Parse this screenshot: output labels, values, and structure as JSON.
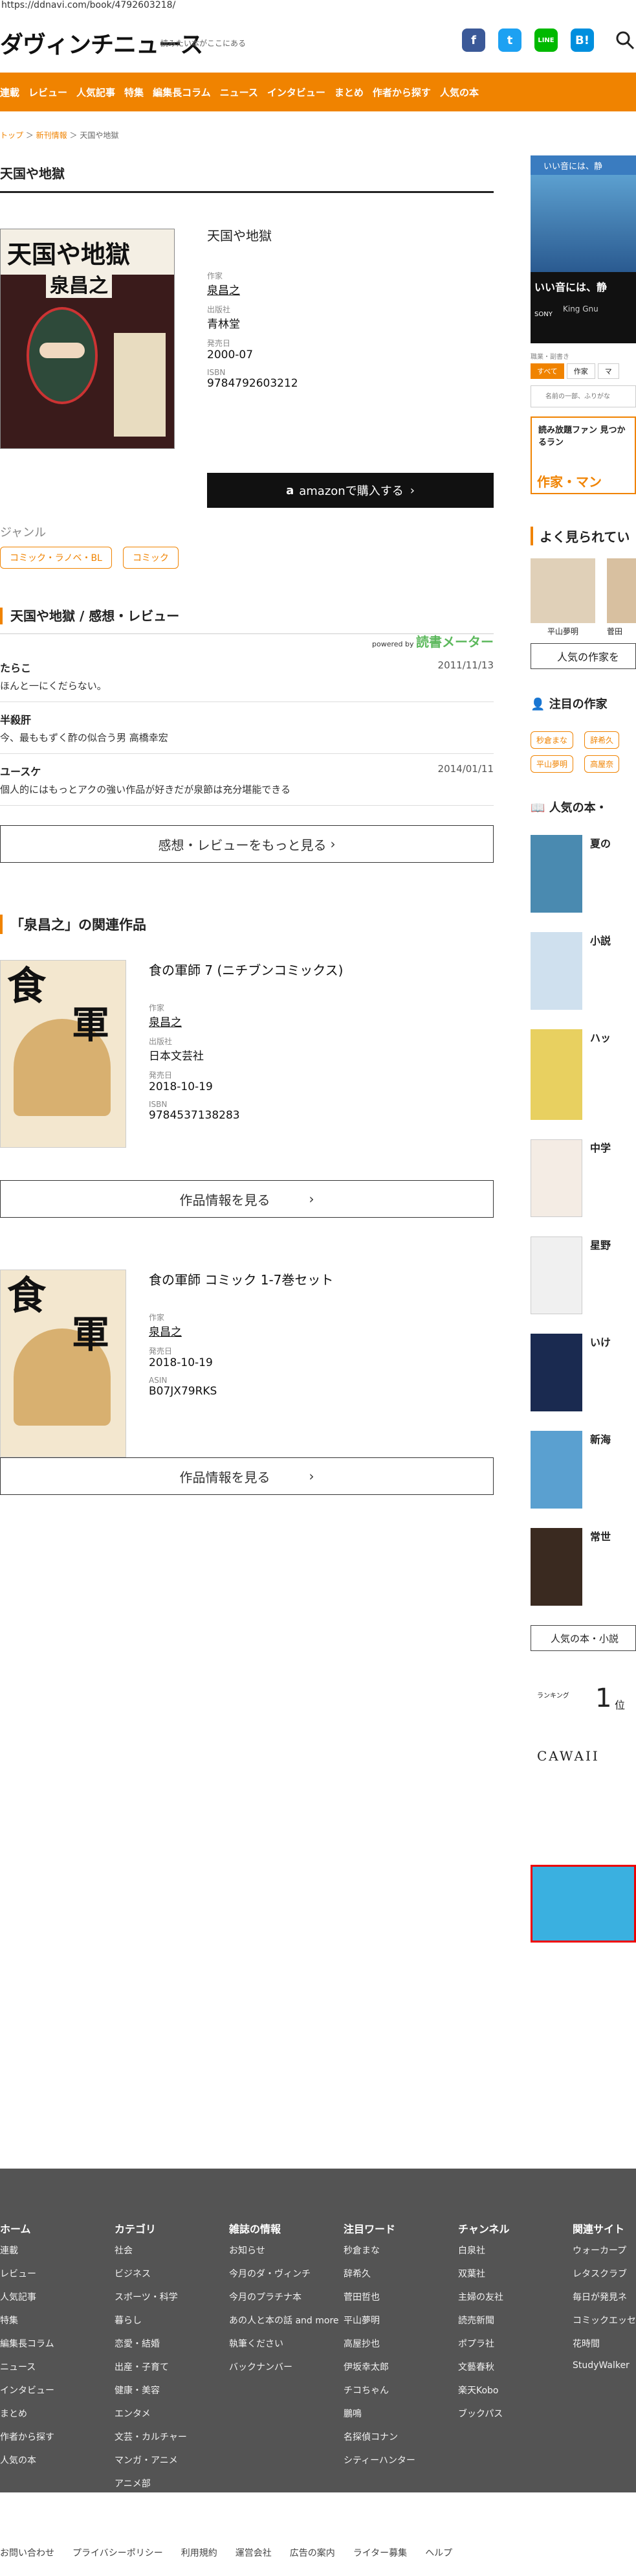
{
  "url": "https://ddnavi.com/book/4792603218/",
  "header": {
    "logo": "ダヴィンチニュース",
    "tagline": "読みたい本がここにある",
    "social": [
      "f",
      "t",
      "LINE",
      "B!"
    ]
  },
  "nav": [
    "連載",
    "レビュー",
    "人気記事",
    "特集",
    "編集長コラム",
    "ニュース",
    "インタビュー",
    "まとめ",
    "作者から探す",
    "人気の本"
  ],
  "breadcrumb": {
    "top": "トップ",
    "new": "新刊情報",
    "current": "天国や地獄"
  },
  "page_title": "天国や地獄",
  "book": {
    "cover_title": "天国や地獄",
    "cover_author": "泉昌之",
    "title": "天国や地獄",
    "author_label": "作家",
    "author": "泉昌之",
    "publisher_label": "出版社",
    "publisher": "青林堂",
    "date_label": "発売日",
    "date": "2000-07",
    "isbn_label": "ISBN",
    "isbn": "9784792603212",
    "amazon_label": "amazonで購入する"
  },
  "genre": {
    "heading": "ジャンル",
    "tags": [
      "コミック・ラノベ・BL",
      "コミック"
    ]
  },
  "reviews": {
    "heading": "天国や地獄 / 感想・レビュー",
    "powered": "powered by",
    "brand": "読書メーター",
    "items": [
      {
        "name": "たらこ",
        "date": "2011/11/13",
        "text": "ほんと一にくだらない。"
      },
      {
        "name": "半殺肝",
        "date": "",
        "text": "今、最ももずく酢の似合う男 高橋幸宏"
      },
      {
        "name": "ユースケ",
        "date": "2014/01/11",
        "text": "個人的にはもっとアクの強い作品が好きだが泉節は充分堪能できる"
      }
    ],
    "more": "感想・レビューをもっと見る"
  },
  "related": {
    "heading": "「泉昌之」の関連作品",
    "items": [
      {
        "title": "食の軍師 7 (ニチブンコミックス)",
        "author_label": "作家",
        "author": "泉昌之",
        "publisher_label": "出版社",
        "publisher": "日本文芸社",
        "date_label": "発売日",
        "date": "2018-10-19",
        "id_label": "ISBN",
        "id": "9784537138283",
        "btn": "作品情報を見る"
      },
      {
        "title": "食の軍師 コミック 1-7巻セット",
        "author_label": "作家",
        "author": "泉昌之",
        "publisher_label": "",
        "publisher": "",
        "date_label": "発売日",
        "date": "2018-10-19",
        "id_label": "ASIN",
        "id": "B07JX79RKS",
        "btn": "作品情報を見る"
      }
    ]
  },
  "sidebar": {
    "ad_text1": "いい音には、静",
    "ad_text2": "King Gnu",
    "sony": "SONY",
    "filter_label": "職業・副書き",
    "filters": [
      "すべて",
      "作家",
      "マ"
    ],
    "search_placeholder": "名前の一部、ふりがな",
    "banner_text": "読み放題ファン 見つかるラン",
    "banner_sub": "作家・マン",
    "popular_heading": "よく見られてい",
    "popular_people": [
      "平山夢明",
      "菅田"
    ],
    "popular_more": "人気の作家を",
    "attention_heading": "注目の作家",
    "attention_tags": [
      "秒倉まな",
      "辞希久",
      "平山夢明",
      "高屋奈"
    ],
    "books_heading": "人気の本・",
    "books": [
      "夏の",
      "小説",
      "ハッ",
      "中学",
      "星野",
      "いけ",
      "新海",
      "常世"
    ],
    "books_more": "人気の本・小説",
    "ranking": {
      "label": "ランキング",
      "rank": "1",
      "unit": "位",
      "brand": "CAWAII"
    }
  },
  "footer": {
    "cols": [
      {
        "h": "ホーム",
        "items": [
          "連載",
          "レビュー",
          "人気記事",
          "特集",
          "編集長コラム",
          "ニュース",
          "インタビュー",
          "まとめ",
          "作者から探す",
          "人気の本"
        ]
      },
      {
        "h": "カテゴリ",
        "items": [
          "社会",
          "ビジネス",
          "スポーツ・科学",
          "暮らし",
          "恋愛・結婚",
          "出産・子育て",
          "健康・美容",
          "エンタメ",
          "文芸・カルチャー",
          "マンガ・アニメ",
          "アニメ部"
        ]
      },
      {
        "h": "雑誌の情報",
        "items": [
          "お知らせ",
          "今月のダ・ヴィンチ",
          "今月のプラチナ本",
          "あの人と本の話 and more",
          "執筆ください",
          "バックナンバー"
        ]
      },
      {
        "h": "注目ワード",
        "items": [
          "秒倉まな",
          "辞希久",
          "菅田哲也",
          "平山夢明",
          "高屋抄也",
          "伊坂幸太郎",
          "チコちゃん",
          "鵬鳴",
          "名探偵コナン",
          "シティーハンター"
        ]
      },
      {
        "h": "チャンネル",
        "items": [
          "白泉社",
          "双葉社",
          "主婦の友社",
          "読売新聞",
          "ポプラ社",
          "文藝春秋",
          "楽天Kobo",
          "ブックパス"
        ]
      },
      {
        "h": "関連サイト",
        "items": [
          "ウォーカープ",
          "レタスクラブ",
          "毎日が発見ネ",
          "コミックエッセ",
          "花時間",
          "StudyWalker"
        ]
      }
    ],
    "bottom": [
      "お問い合わせ",
      "プライバシーポリシー",
      "利用規約",
      "運営会社",
      "広告の案内",
      "ライター募集",
      "ヘルプ"
    ]
  }
}
